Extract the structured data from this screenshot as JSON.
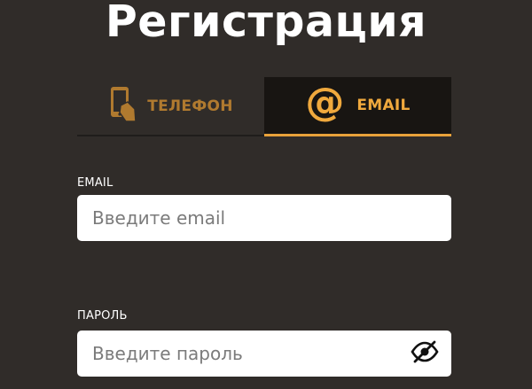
{
  "page": {
    "title": "Регистрация"
  },
  "tabs": [
    {
      "label": "ТЕЛЕФОН",
      "icon": "phone-hand-icon",
      "active": false
    },
    {
      "label": "EMAIL",
      "icon": "at-icon",
      "active": true
    }
  ],
  "form": {
    "email_label": "EMAIL",
    "email_placeholder": "Введите email",
    "email_value": "",
    "password_label": "ПАРОЛЬ",
    "password_placeholder": "Введите пароль",
    "password_value": "",
    "password_toggle_icon": "eye-slash-icon"
  },
  "colors": {
    "background": "#302c29",
    "accent": "#f0a93d",
    "inactive_tab_text": "#b07a2f",
    "active_tab_bg": "#181512"
  }
}
